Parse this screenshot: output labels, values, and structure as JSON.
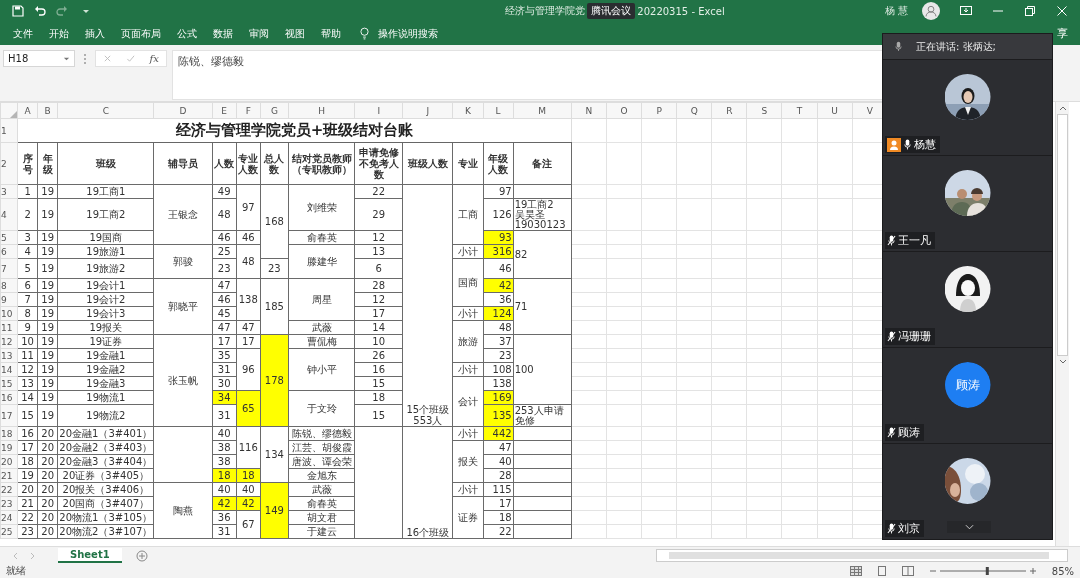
{
  "title_bar": {
    "title_start": "经济与管理学院党",
    "overlay_label": "腾讯会议",
    "title_end": "20220315 - Excel",
    "user": "杨 慧"
  },
  "menu": [
    "文件",
    "开始",
    "插入",
    "页面布局",
    "公式",
    "数据",
    "审阅",
    "视图",
    "帮助"
  ],
  "tell_me": "操作说明搜索",
  "share": "享",
  "formula_bar": {
    "name_box": "H18",
    "function_label": "fx",
    "content": "陈锐、缪德毅"
  },
  "columns": [
    "A",
    "B",
    "C",
    "D",
    "E",
    "F",
    "G",
    "H",
    "I",
    "J",
    "K",
    "L",
    "M",
    "N",
    "O",
    "P",
    "Q",
    "R",
    "S",
    "T",
    "U",
    "V"
  ],
  "sheet": {
    "title_row_number": "1",
    "header_row_number": "2",
    "title": "经济与管理学院党员+班级结对台账",
    "headers": [
      "序号",
      "年级",
      "班级",
      "辅导员",
      "人数",
      "专业人数",
      "总人数",
      "结对党员教师（专职教师）",
      "申请免修不免考人数",
      "班级人数",
      "专业",
      "年级人数",
      "备注"
    ],
    "rows": [
      {
        "number": "3",
        "cells": [
          {
            "text": "1",
            "highlighted": false
          },
          {
            "text": "19",
            "highlighted": false
          },
          {
            "text": "19工商1",
            "highlighted": false
          },
          {
            "text": "王银念",
            "highlighted": false,
            "rowspan": 3
          },
          {
            "text": "49",
            "highlighted": false
          },
          {
            "text": "97",
            "highlighted": false,
            "rowspan": 2
          },
          {
            "text": "168",
            "highlighted": false,
            "rowspan": 4
          },
          {
            "text": "刘维荣",
            "highlighted": false,
            "rowspan": 2
          },
          {
            "text": "22",
            "highlighted": false
          },
          {
            "text": "15个班级\n553人",
            "highlighted": false,
            "rowspan": 15
          },
          {
            "text": "工商",
            "highlighted": false,
            "rowspan": 3
          },
          {
            "text": "97",
            "highlighted": false
          },
          {
            "highlighted": false
          }
        ]
      },
      {
        "number": "4",
        "cells": [
          {
            "text": "2",
            "highlighted": false
          },
          {
            "text": "19",
            "highlighted": false
          },
          {
            "text": "19工商2",
            "highlighted": false
          },
          {
            "text": "48",
            "highlighted": false
          },
          {
            "text": "29",
            "highlighted": false
          },
          {
            "text": "126",
            "highlighted": false
          },
          {
            "text": "19工商2\n吴昊圣\n19030123",
            "highlighted": false
          }
        ]
      },
      {
        "number": "5",
        "cells": [
          {
            "text": "3",
            "highlighted": false
          },
          {
            "text": "19",
            "highlighted": false
          },
          {
            "text": "19国商",
            "highlighted": false
          },
          {
            "text": "46",
            "highlighted": false
          },
          {
            "text": "46",
            "highlighted": false
          },
          {
            "text": "俞春英",
            "highlighted": false
          },
          {
            "text": "12",
            "highlighted": false
          },
          {
            "text": "93",
            "highlighted": true
          },
          {
            "text": "82",
            "highlighted": false,
            "rowspan": 3
          }
        ]
      },
      {
        "number": "6",
        "cells": [
          {
            "text": "4",
            "highlighted": false
          },
          {
            "text": "19",
            "highlighted": false
          },
          {
            "text": "19旅游1",
            "highlighted": false
          },
          {
            "text": "郭骏",
            "highlighted": false,
            "rowspan": 2
          },
          {
            "text": "25",
            "highlighted": false
          },
          {
            "text": "48",
            "highlighted": false,
            "rowspan": 2
          },
          {
            "text": "滕建华",
            "highlighted": false,
            "rowspan": 2
          },
          {
            "text": "13",
            "highlighted": false
          },
          {
            "text": "小计",
            "highlighted": false
          },
          {
            "text": "316",
            "highlighted": true
          }
        ]
      },
      {
        "number": "7",
        "cells": [
          {
            "text": "5",
            "highlighted": false
          },
          {
            "text": "19",
            "highlighted": false
          },
          {
            "text": "19旅游2",
            "highlighted": false
          },
          {
            "text": "23",
            "highlighted": false
          },
          {
            "text": "23",
            "highlighted": false
          },
          {
            "text": "6",
            "highlighted": false
          },
          {
            "text": "国商",
            "highlighted": false,
            "rowspan": 3
          },
          {
            "text": "46",
            "highlighted": false
          }
        ]
      },
      {
        "number": "8",
        "cells": [
          {
            "text": "6",
            "highlighted": false
          },
          {
            "text": "19",
            "highlighted": false
          },
          {
            "text": "19会计1",
            "highlighted": false
          },
          {
            "text": "郭晓平",
            "highlighted": false,
            "rowspan": 4
          },
          {
            "text": "47",
            "highlighted": false
          },
          {
            "text": "138",
            "highlighted": false,
            "rowspan": 3
          },
          {
            "text": "185",
            "highlighted": false,
            "rowspan": 4
          },
          {
            "text": "周星",
            "highlighted": false,
            "rowspan": 3
          },
          {
            "text": "28",
            "highlighted": false
          },
          {
            "text": "42",
            "highlighted": true
          },
          {
            "text": "71",
            "highlighted": false,
            "rowspan": 4
          }
        ]
      },
      {
        "number": "9",
        "cells": [
          {
            "text": "7",
            "highlighted": false
          },
          {
            "text": "19",
            "highlighted": false
          },
          {
            "text": "19会计2",
            "highlighted": false
          },
          {
            "text": "46",
            "highlighted": false
          },
          {
            "text": "12",
            "highlighted": false
          },
          {
            "text": "36",
            "highlighted": false
          }
        ]
      },
      {
        "number": "10",
        "cells": [
          {
            "text": "8",
            "highlighted": false
          },
          {
            "text": "19",
            "highlighted": false
          },
          {
            "text": "19会计3",
            "highlighted": false
          },
          {
            "text": "45",
            "highlighted": false
          },
          {
            "text": "17",
            "highlighted": false
          },
          {
            "text": "小计",
            "highlighted": false
          },
          {
            "text": "124",
            "highlighted": true
          }
        ]
      },
      {
        "number": "11",
        "cells": [
          {
            "text": "9",
            "highlighted": false
          },
          {
            "text": "19",
            "highlighted": false
          },
          {
            "text": "19报关",
            "highlighted": false
          },
          {
            "text": "47",
            "highlighted": false
          },
          {
            "text": "47",
            "highlighted": false
          },
          {
            "text": "武薇",
            "highlighted": false
          },
          {
            "text": "14",
            "highlighted": false
          },
          {
            "text": "旅游",
            "highlighted": false,
            "rowspan": 3
          },
          {
            "text": "48",
            "highlighted": false
          }
        ]
      },
      {
        "number": "12",
        "cells": [
          {
            "text": "10",
            "highlighted": false
          },
          {
            "text": "19",
            "highlighted": false
          },
          {
            "text": "19证券",
            "highlighted": false
          },
          {
            "text": "张玉帆",
            "highlighted": false,
            "rowspan": 6
          },
          {
            "text": "17",
            "highlighted": false
          },
          {
            "text": "17",
            "highlighted": false
          },
          {
            "text": "178",
            "highlighted": true,
            "rowspan": 6
          },
          {
            "text": "曹侃梅",
            "highlighted": false
          },
          {
            "text": "10",
            "highlighted": false
          },
          {
            "text": "37",
            "highlighted": false
          },
          {
            "text": "100",
            "highlighted": false,
            "rowspan": 5
          }
        ]
      },
      {
        "number": "13",
        "cells": [
          {
            "text": "11",
            "highlighted": false
          },
          {
            "text": "19",
            "highlighted": false
          },
          {
            "text": "19金融1",
            "highlighted": false
          },
          {
            "text": "35",
            "highlighted": false
          },
          {
            "text": "96",
            "highlighted": false,
            "rowspan": 3
          },
          {
            "text": "钟小平",
            "highlighted": false,
            "rowspan": 3
          },
          {
            "text": "26",
            "highlighted": false
          },
          {
            "text": "23",
            "highlighted": false
          }
        ]
      },
      {
        "number": "14",
        "cells": [
          {
            "text": "12",
            "highlighted": false
          },
          {
            "text": "19",
            "highlighted": false
          },
          {
            "text": "19金融2",
            "highlighted": false
          },
          {
            "text": "31",
            "highlighted": false
          },
          {
            "text": "16",
            "highlighted": false
          },
          {
            "text": "小计",
            "highlighted": false
          },
          {
            "text": "108",
            "highlighted": false
          }
        ]
      },
      {
        "number": "15",
        "cells": [
          {
            "text": "13",
            "highlighted": false
          },
          {
            "text": "19",
            "highlighted": false
          },
          {
            "text": "19金融3",
            "highlighted": false
          },
          {
            "text": "30",
            "highlighted": false
          },
          {
            "text": "15",
            "highlighted": false
          },
          {
            "text": "会计",
            "highlighted": false,
            "rowspan": 3
          },
          {
            "text": "138",
            "highlighted": false
          }
        ]
      },
      {
        "number": "16",
        "cells": [
          {
            "text": "14",
            "highlighted": false
          },
          {
            "text": "19",
            "highlighted": false
          },
          {
            "text": "19物流1",
            "highlighted": false
          },
          {
            "text": "34",
            "highlighted": true
          },
          {
            "text": "65",
            "highlighted": true,
            "rowspan": 2
          },
          {
            "text": "于文玲",
            "highlighted": false,
            "rowspan": 2
          },
          {
            "text": "18",
            "highlighted": false
          },
          {
            "text": "169",
            "highlighted": true
          }
        ]
      },
      {
        "number": "17",
        "cells": [
          {
            "text": "15",
            "highlighted": false
          },
          {
            "text": "19",
            "highlighted": false
          },
          {
            "text": "19物流2",
            "highlighted": false
          },
          {
            "text": "31",
            "highlighted": false
          },
          {
            "text": "15",
            "highlighted": false
          },
          {
            "text": "135",
            "highlighted": true
          },
          {
            "text": "253人申请免修",
            "highlighted": false
          }
        ]
      },
      {
        "number": "18",
        "cells": [
          {
            "text": "16",
            "highlighted": false
          },
          {
            "text": "20",
            "highlighted": false
          },
          {
            "text": "20金融1（3#401）",
            "highlighted": false
          },
          {
            "highlighted": false,
            "rowspan": 4
          },
          {
            "text": "40",
            "highlighted": false
          },
          {
            "text": "116",
            "highlighted": false,
            "rowspan": 3
          },
          {
            "text": "134",
            "highlighted": false,
            "rowspan": 4
          },
          {
            "text": "陈锐、缪德毅",
            "highlighted": false
          },
          {
            "highlighted": false,
            "rowspan": 8
          },
          {
            "text": "16个班级",
            "highlighted": false,
            "rowspan": 8
          },
          {
            "text": "小计",
            "highlighted": false
          },
          {
            "text": "442",
            "highlighted": true
          },
          {
            "highlighted": false
          }
        ]
      },
      {
        "number": "19",
        "cells": [
          {
            "text": "17",
            "highlighted": false
          },
          {
            "text": "20",
            "highlighted": false
          },
          {
            "text": "20金融2（3#403）",
            "highlighted": false
          },
          {
            "text": "38",
            "highlighted": false
          },
          {
            "text": "江芸、胡俊霞",
            "highlighted": false
          },
          {
            "text": "报关",
            "highlighted": false,
            "rowspan": 3
          },
          {
            "text": "47",
            "highlighted": false
          },
          {
            "highlighted": false
          }
        ]
      },
      {
        "number": "20",
        "cells": [
          {
            "text": "18",
            "highlighted": false
          },
          {
            "text": "20",
            "highlighted": false
          },
          {
            "text": "20金融3（3#404）",
            "highlighted": false
          },
          {
            "text": "38",
            "highlighted": false
          },
          {
            "text": "唐波、谭会荣",
            "highlighted": false
          },
          {
            "text": "40",
            "highlighted": false
          },
          {
            "highlighted": false
          }
        ]
      },
      {
        "number": "21",
        "cells": [
          {
            "text": "19",
            "highlighted": false
          },
          {
            "text": "20",
            "highlighted": false
          },
          {
            "text": "20证券（3#405）",
            "highlighted": false
          },
          {
            "text": "18",
            "highlighted": true
          },
          {
            "text": "18",
            "highlighted": true
          },
          {
            "text": "金旭东",
            "highlighted": false
          },
          {
            "text": "28",
            "highlighted": false
          },
          {
            "highlighted": false
          }
        ]
      },
      {
        "number": "22",
        "cells": [
          {
            "text": "20",
            "highlighted": false
          },
          {
            "text": "20",
            "highlighted": false
          },
          {
            "text": "20报关（3#406）",
            "highlighted": false
          },
          {
            "text": "陶燕",
            "highlighted": false,
            "rowspan": 4
          },
          {
            "text": "40",
            "highlighted": false
          },
          {
            "text": "40",
            "highlighted": false
          },
          {
            "text": "149",
            "highlighted": true,
            "rowspan": 4
          },
          {
            "text": "武薇",
            "highlighted": false
          },
          {
            "text": "小计",
            "highlighted": false
          },
          {
            "text": "115",
            "highlighted": false
          },
          {
            "highlighted": false
          }
        ]
      },
      {
        "number": "23",
        "cells": [
          {
            "text": "21",
            "highlighted": false
          },
          {
            "text": "20",
            "highlighted": false
          },
          {
            "text": "20国商（3#407）",
            "highlighted": false
          },
          {
            "text": "42",
            "highlighted": true
          },
          {
            "text": "42",
            "highlighted": true
          },
          {
            "text": "俞春英",
            "highlighted": false
          },
          {
            "text": "证券",
            "highlighted": false,
            "rowspan": 3
          },
          {
            "text": "17",
            "highlighted": false
          },
          {
            "highlighted": false
          }
        ]
      },
      {
        "number": "24",
        "cells": [
          {
            "text": "22",
            "highlighted": false
          },
          {
            "text": "20",
            "highlighted": false
          },
          {
            "text": "20物流1（3#105）",
            "highlighted": false
          },
          {
            "text": "36",
            "highlighted": false
          },
          {
            "text": "67",
            "highlighted": false,
            "rowspan": 2
          },
          {
            "text": "胡文君",
            "highlighted": false
          },
          {
            "text": "18",
            "highlighted": false
          },
          {
            "highlighted": false
          }
        ]
      },
      {
        "number": "25",
        "cells": [
          {
            "text": "23",
            "highlighted": false
          },
          {
            "text": "20",
            "highlighted": false
          },
          {
            "text": "20物流2（3#107）",
            "highlighted": false
          },
          {
            "text": "31",
            "highlighted": false
          },
          {
            "text": "于建云",
            "highlighted": false
          },
          {
            "text": "22",
            "highlighted": false
          },
          {
            "highlighted": false
          }
        ]
      }
    ]
  },
  "sheet_tabs": [
    {
      "label": "Sheet1",
      "selected": true
    }
  ],
  "status": "就绪",
  "zoom": "85%",
  "zoom_slider": {
    "level": 0.55
  },
  "meeting": {
    "speaking": "正在讲话: 张炳达;",
    "participants": [
      {
        "name": "杨慧",
        "host": true,
        "muted": false
      },
      {
        "name": "王一凡",
        "host": false,
        "muted": true
      },
      {
        "name": "冯珊珊",
        "host": false,
        "muted": true
      },
      {
        "name": "顾涛",
        "kind": "initials",
        "initials": "顾涛",
        "host": false,
        "muted": true
      },
      {
        "name": "刘京",
        "host": false,
        "muted": true
      }
    ]
  }
}
